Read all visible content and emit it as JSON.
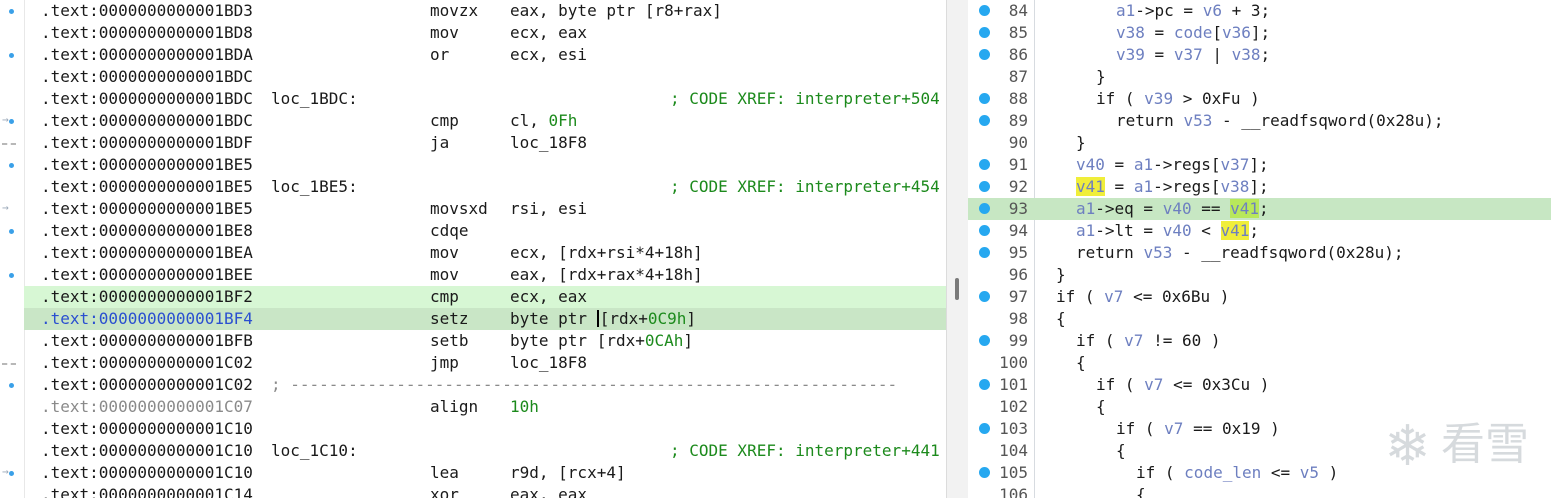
{
  "disasm": {
    "rows": [
      {
        "addr": ".text:0000000000001BD3",
        "label": "",
        "mn": "movzx",
        "op": "eax, byte ptr [r8+rax]",
        "cmt": ""
      },
      {
        "addr": ".text:0000000000001BD8",
        "label": "",
        "mn": "mov",
        "op": "ecx, eax",
        "cmt": ""
      },
      {
        "addr": ".text:0000000000001BDA",
        "label": "",
        "mn": "or",
        "op": "ecx, esi",
        "cmt": ""
      },
      {
        "addr": ".text:0000000000001BDC",
        "label": "",
        "mn": "",
        "op": "",
        "cmt": ""
      },
      {
        "addr": ".text:0000000000001BDC",
        "label": "loc_1BDC:",
        "mn": "",
        "op": "",
        "cmt": "; CODE XREF: interpreter+504"
      },
      {
        "addr": ".text:0000000000001BDC",
        "label": "",
        "mn": "cmp",
        "op": "cl, ",
        "opnum": "0Fh",
        "cmt": ""
      },
      {
        "addr": ".text:0000000000001BDF",
        "label": "",
        "mn": "ja",
        "op": "loc_18F8",
        "cmt": ""
      },
      {
        "addr": ".text:0000000000001BE5",
        "label": "",
        "mn": "",
        "op": "",
        "cmt": ""
      },
      {
        "addr": ".text:0000000000001BE5",
        "label": "loc_1BE5:",
        "mn": "",
        "op": "",
        "cmt": "; CODE XREF: interpreter+454"
      },
      {
        "addr": ".text:0000000000001BE5",
        "label": "",
        "mn": "movsxd",
        "op": "rsi, esi",
        "cmt": ""
      },
      {
        "addr": ".text:0000000000001BE8",
        "label": "",
        "mn": "cdqe",
        "op": "",
        "cmt": ""
      },
      {
        "addr": ".text:0000000000001BEA",
        "label": "",
        "mn": "mov",
        "op": "ecx, [rdx+rsi*4+18h]",
        "cmt": ""
      },
      {
        "addr": ".text:0000000000001BEE",
        "label": "",
        "mn": "mov",
        "op": "eax, [rdx+rax*4+18h]",
        "cmt": ""
      },
      {
        "addr": ".text:0000000000001BF2",
        "label": "",
        "mn": "cmp",
        "op": "ecx, eax",
        "cmt": "",
        "hl": "cmp"
      },
      {
        "addr": ".text:0000000000001BF4",
        "label": "",
        "mn": "setz",
        "op": "byte ptr ",
        "caret": true,
        "op2": "[rdx+",
        "opnum": "0C9h",
        "op3": "]",
        "cmt": "",
        "hl": "cur"
      },
      {
        "addr": ".text:0000000000001BFB",
        "label": "",
        "mn": "setb",
        "op": "byte ptr [rdx+",
        "opnum": "0CAh",
        "op3": "]",
        "cmt": ""
      },
      {
        "addr": ".text:0000000000001C02",
        "label": "",
        "mn": "jmp",
        "op": "loc_18F8",
        "cmt": ""
      },
      {
        "addr": ".text:0000000000001C02",
        "label": "",
        "mn": "",
        "op": "",
        "cmt": "",
        "sep": "; ---------------------------------------------------------------"
      },
      {
        "addr": ".text:0000000000001C07",
        "label": "",
        "mn": "align",
        "op": "",
        "opnum": "10h",
        "cmt": "",
        "gray": true
      },
      {
        "addr": ".text:0000000000001C10",
        "label": "",
        "mn": "",
        "op": "",
        "cmt": ""
      },
      {
        "addr": ".text:0000000000001C10",
        "label": "loc_1C10:",
        "mn": "",
        "op": "",
        "cmt": "; CODE XREF: interpreter+441"
      },
      {
        "addr": ".text:0000000000001C10",
        "label": "",
        "mn": "lea",
        "op": "r9d, [rcx+4]",
        "cmt": ""
      },
      {
        "addr": ".text:0000000000001C14",
        "label": "",
        "mn": "xor",
        "op": "eax, eax",
        "cmt": ""
      }
    ]
  },
  "pseudo": {
    "lines": [
      {
        "n": "84",
        "bp": true,
        "indent": 4,
        "t": [
          [
            "var",
            "a1"
          ],
          [
            "",
            "->pc = "
          ],
          [
            "var",
            "v6"
          ],
          [
            "",
            " + 3;"
          ]
        ]
      },
      {
        "n": "85",
        "bp": true,
        "indent": 4,
        "t": [
          [
            "var",
            "v38"
          ],
          [
            "",
            " = "
          ],
          [
            "var",
            "code"
          ],
          [
            "",
            "["
          ],
          [
            "var",
            "v36"
          ],
          [
            "",
            "];"
          ]
        ]
      },
      {
        "n": "86",
        "bp": true,
        "indent": 4,
        "t": [
          [
            "var",
            "v39"
          ],
          [
            "",
            " = "
          ],
          [
            "var",
            "v37"
          ],
          [
            "",
            " | "
          ],
          [
            "var",
            "v38"
          ],
          [
            "",
            ";"
          ]
        ]
      },
      {
        "n": "87",
        "bp": false,
        "indent": 3,
        "t": [
          [
            "",
            "}"
          ]
        ]
      },
      {
        "n": "88",
        "bp": true,
        "indent": 3,
        "t": [
          [
            "",
            "if ( "
          ],
          [
            "var",
            "v39"
          ],
          [
            "",
            " > 0xFu )"
          ]
        ]
      },
      {
        "n": "89",
        "bp": true,
        "indent": 4,
        "t": [
          [
            "",
            "return "
          ],
          [
            "var",
            "v53"
          ],
          [
            "",
            " - __readfsqword(0x28u);"
          ]
        ]
      },
      {
        "n": "90",
        "bp": false,
        "indent": 2,
        "t": [
          [
            "",
            "}"
          ]
        ]
      },
      {
        "n": "91",
        "bp": true,
        "indent": 2,
        "t": [
          [
            "var",
            "v40"
          ],
          [
            "",
            " = "
          ],
          [
            "var",
            "a1"
          ],
          [
            "",
            "->regs["
          ],
          [
            "var",
            "v37"
          ],
          [
            "",
            "];"
          ]
        ]
      },
      {
        "n": "92",
        "bp": true,
        "indent": 2,
        "t": [
          [
            "hv",
            "v41"
          ],
          [
            "",
            " = "
          ],
          [
            "var",
            "a1"
          ],
          [
            "",
            "->regs["
          ],
          [
            "var",
            "v38"
          ],
          [
            "",
            "];"
          ]
        ]
      },
      {
        "n": "93",
        "bp": true,
        "indent": 2,
        "hl": true,
        "t": [
          [
            "var",
            "a1"
          ],
          [
            "",
            "->eq = "
          ],
          [
            "var",
            "v40"
          ],
          [
            "",
            " == "
          ],
          [
            "hvg",
            "v41"
          ],
          [
            "",
            ";"
          ]
        ]
      },
      {
        "n": "94",
        "bp": true,
        "indent": 2,
        "t": [
          [
            "var",
            "a1"
          ],
          [
            "",
            "->lt = "
          ],
          [
            "var",
            "v40"
          ],
          [
            "",
            " < "
          ],
          [
            "hv",
            "v41"
          ],
          [
            "",
            ";"
          ]
        ]
      },
      {
        "n": "95",
        "bp": true,
        "indent": 2,
        "t": [
          [
            "",
            "return "
          ],
          [
            "var",
            "v53"
          ],
          [
            "",
            " - __readfsqword(0x28u);"
          ]
        ]
      },
      {
        "n": "96",
        "bp": false,
        "indent": 1,
        "t": [
          [
            "",
            "}"
          ]
        ]
      },
      {
        "n": "97",
        "bp": true,
        "indent": 1,
        "t": [
          [
            "",
            "if ( "
          ],
          [
            "var",
            "v7"
          ],
          [
            "",
            " <= 0x6Bu )"
          ]
        ]
      },
      {
        "n": "98",
        "bp": false,
        "indent": 1,
        "t": [
          [
            "",
            "{"
          ]
        ]
      },
      {
        "n": "99",
        "bp": true,
        "indent": 2,
        "t": [
          [
            "",
            "if ( "
          ],
          [
            "var",
            "v7"
          ],
          [
            "",
            " != 60 )"
          ]
        ]
      },
      {
        "n": "100",
        "bp": false,
        "indent": 2,
        "t": [
          [
            "",
            "{"
          ]
        ]
      },
      {
        "n": "101",
        "bp": true,
        "indent": 3,
        "t": [
          [
            "",
            "if ( "
          ],
          [
            "var",
            "v7"
          ],
          [
            "",
            " <= 0x3Cu )"
          ]
        ]
      },
      {
        "n": "102",
        "bp": false,
        "indent": 3,
        "t": [
          [
            "",
            "{"
          ]
        ]
      },
      {
        "n": "103",
        "bp": true,
        "indent": 4,
        "t": [
          [
            "",
            "if ( "
          ],
          [
            "var",
            "v7"
          ],
          [
            "",
            " == 0x19 )"
          ]
        ]
      },
      {
        "n": "104",
        "bp": false,
        "indent": 4,
        "t": [
          [
            "",
            "{"
          ]
        ]
      },
      {
        "n": "105",
        "bp": true,
        "indent": 5,
        "t": [
          [
            "",
            "if ( "
          ],
          [
            "var",
            "code_len"
          ],
          [
            "",
            " <= "
          ],
          [
            "var",
            "v5"
          ],
          [
            "",
            " )"
          ]
        ]
      },
      {
        "n": "106",
        "bp": false,
        "indent": 5,
        "t": [
          [
            "",
            "{"
          ]
        ]
      }
    ]
  },
  "watermark": {
    "flake": "❄",
    "text": "看雪"
  },
  "colors": {
    "accent_bp": "#26a8f0",
    "hl_green": "#c7e7c3",
    "var_yellow": "#f0ee3a"
  }
}
